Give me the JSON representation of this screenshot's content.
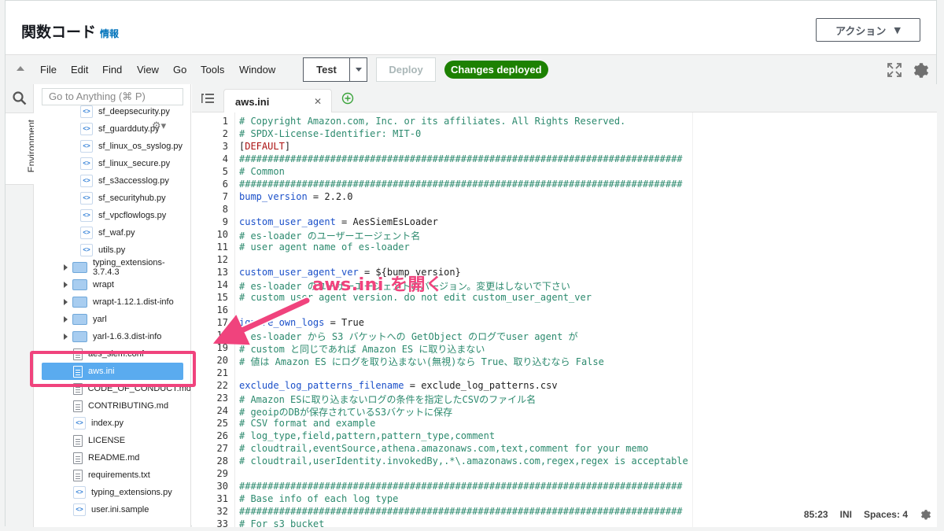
{
  "header": {
    "title": "関数コード",
    "info_link": "情報",
    "action_button": "アクション"
  },
  "menubar": {
    "items": [
      "File",
      "Edit",
      "Find",
      "View",
      "Go",
      "Tools",
      "Window"
    ],
    "test_button": "Test",
    "deploy_button": "Deploy",
    "status_badge": "Changes deployed"
  },
  "sidebar": {
    "environment_tab": "Environment",
    "goto_placeholder": "Go to Anything (⌘ P)"
  },
  "tree": {
    "items": [
      {
        "name": "sf_deepsecurity.py",
        "icon": "python-file-icon"
      },
      {
        "name": "sf_guardduty.py",
        "icon": "python-file-icon"
      },
      {
        "name": "sf_linux_os_syslog.py",
        "icon": "python-file-icon"
      },
      {
        "name": "sf_linux_secure.py",
        "icon": "python-file-icon"
      },
      {
        "name": "sf_s3accesslog.py",
        "icon": "python-file-icon"
      },
      {
        "name": "sf_securityhub.py",
        "icon": "python-file-icon"
      },
      {
        "name": "sf_vpcflowlogs.py",
        "icon": "python-file-icon"
      },
      {
        "name": "sf_waf.py",
        "icon": "python-file-icon"
      },
      {
        "name": "utils.py",
        "icon": "python-file-icon"
      },
      {
        "name": "typing_extensions-3.7.4.3",
        "icon": "folder-icon"
      },
      {
        "name": "wrapt",
        "icon": "folder-icon"
      },
      {
        "name": "wrapt-1.12.1.dist-info",
        "icon": "folder-icon"
      },
      {
        "name": "yarl",
        "icon": "folder-icon"
      },
      {
        "name": "yarl-1.6.3.dist-info",
        "icon": "folder-icon"
      },
      {
        "name": "aes_siem.conf",
        "icon": "file-icon"
      },
      {
        "name": "aws.ini",
        "icon": "file-icon"
      },
      {
        "name": "CODE_OF_CONDUCT.md",
        "icon": "file-icon"
      },
      {
        "name": "CONTRIBUTING.md",
        "icon": "file-icon"
      },
      {
        "name": "index.py",
        "icon": "python-file-icon"
      },
      {
        "name": "LICENSE",
        "icon": "file-icon"
      },
      {
        "name": "README.md",
        "icon": "file-icon"
      },
      {
        "name": "requirements.txt",
        "icon": "file-icon"
      },
      {
        "name": "typing_extensions.py",
        "icon": "python-file-icon"
      },
      {
        "name": "user.ini.sample",
        "icon": "python-file-icon"
      }
    ],
    "selected_index": 15
  },
  "editor": {
    "active_tab": "aws.ini",
    "lines": [
      {
        "n": "1",
        "t": "# Copyright Amazon.com, Inc. or its affiliates. All Rights Reserved.",
        "k": "comment"
      },
      {
        "n": "2",
        "t": "# SPDX-License-Identifier: MIT-0",
        "k": "comment"
      },
      {
        "n": "3",
        "t": "[DEFAULT]",
        "k": "section"
      },
      {
        "n": "4",
        "t": "##############################################################################",
        "k": "comment"
      },
      {
        "n": "5",
        "t": "# Common",
        "k": "comment"
      },
      {
        "n": "6",
        "t": "##############################################################################",
        "k": "comment"
      },
      {
        "n": "7",
        "t": "bump_version = 2.2.0",
        "k": "kv"
      },
      {
        "n": "8",
        "t": "",
        "k": "plain"
      },
      {
        "n": "9",
        "t": "custom_user_agent = AesSiemEsLoader",
        "k": "kv"
      },
      {
        "n": "10",
        "t": "# es-loader のユーザーエージェント名",
        "k": "comment"
      },
      {
        "n": "11",
        "t": "# user agent name of es-loader",
        "k": "comment"
      },
      {
        "n": "12",
        "t": "",
        "k": "plain"
      },
      {
        "n": "13",
        "t": "custom_user_agent_ver = ${bump_version}",
        "k": "kv"
      },
      {
        "n": "14",
        "t": "# es-loader のユーザーエージェントのバージョン。変更はしないで下さい",
        "k": "comment"
      },
      {
        "n": "15",
        "t": "# custom user agent version. do not edit custom_user_agent_ver",
        "k": "comment"
      },
      {
        "n": "16",
        "t": "",
        "k": "plain"
      },
      {
        "n": "17",
        "t": "ignore_own_logs = True",
        "k": "kv"
      },
      {
        "n": "18",
        "t": "# es-loader から S3 バケットへの GetObject のログでuser agent が",
        "k": "comment"
      },
      {
        "n": "19",
        "t": "# custom と同じであれば Amazon ES に取り込まない",
        "k": "comment"
      },
      {
        "n": "20",
        "t": "# 値は Amazon ES にログを取り込まない(無視)なら True、取り込むなら False",
        "k": "comment"
      },
      {
        "n": "21",
        "t": "",
        "k": "plain"
      },
      {
        "n": "22",
        "t": "exclude_log_patterns_filename = exclude_log_patterns.csv",
        "k": "kv"
      },
      {
        "n": "23",
        "t": "# Amazon ESに取り込まないログの条件を指定したCSVのファイル名",
        "k": "comment"
      },
      {
        "n": "24",
        "t": "# geoipのDBが保存されているS3バケットに保存",
        "k": "comment"
      },
      {
        "n": "25",
        "t": "# CSV format and example",
        "k": "comment"
      },
      {
        "n": "26",
        "t": "# log_type,field,pattern,pattern_type,comment",
        "k": "comment"
      },
      {
        "n": "27",
        "t": "# cloudtrail,eventSource,athena.amazonaws.com,text,comment for your memo",
        "k": "comment"
      },
      {
        "n": "28",
        "t": "# cloudtrail,userIdentity.invokedBy,.*\\.amazonaws.com,regex,regex is acceptable",
        "k": "comment"
      },
      {
        "n": "29",
        "t": "",
        "k": "plain"
      },
      {
        "n": "30",
        "t": "##############################################################################",
        "k": "comment"
      },
      {
        "n": "31",
        "t": "# Base info of each log type",
        "k": "comment"
      },
      {
        "n": "32",
        "t": "##############################################################################",
        "k": "comment"
      },
      {
        "n": "33",
        "t": "# For s3 bucket",
        "k": "comment"
      }
    ]
  },
  "statusbar": {
    "cursor": "85:23",
    "mode": "INI",
    "spaces": "Spaces: 4"
  },
  "annotation": {
    "callout_text": "aws.ini を開く",
    "color": "#f0437d"
  },
  "colors": {
    "deployed_badge": "#1d8102",
    "selected_row": "#5aabef",
    "info_link": "#0073bb"
  }
}
